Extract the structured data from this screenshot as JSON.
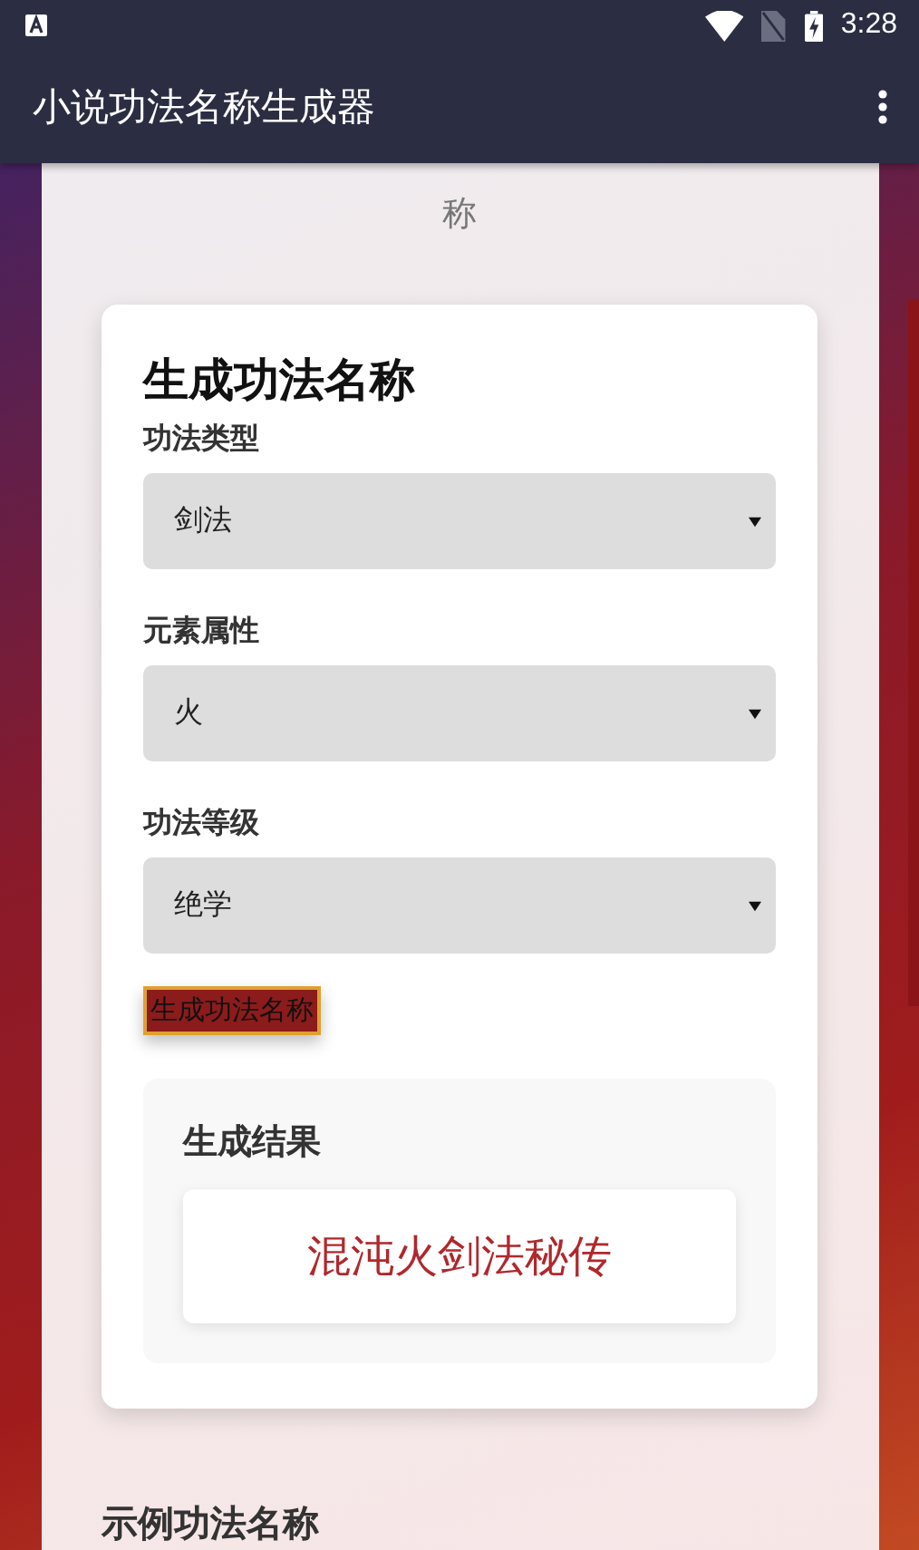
{
  "status_bar": {
    "time": "3:28"
  },
  "app_bar": {
    "title": "小说功法名称生成器"
  },
  "subtitle": "称",
  "form": {
    "title": "生成功法名称",
    "fields": [
      {
        "label": "功法类型",
        "value": "剑法"
      },
      {
        "label": "元素属性",
        "value": "火"
      },
      {
        "label": "功法等级",
        "value": "绝学"
      }
    ],
    "button": "生成功法名称"
  },
  "result": {
    "title": "生成结果",
    "name": "混沌火剑法秘传"
  },
  "examples": {
    "title": "示例功法名称"
  }
}
